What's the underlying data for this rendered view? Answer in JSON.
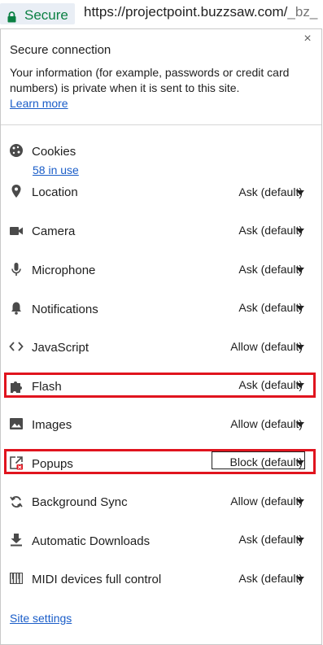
{
  "address_bar": {
    "secure_label": "Secure",
    "url_main": "https://projectpoint.buzzsaw.com/",
    "url_dim": "_bz_"
  },
  "popup": {
    "close_glyph": "×",
    "title": "Secure connection",
    "description": "Your information (for example, passwords or credit card numbers) is private when it is sent to this site.",
    "learn_more": "Learn more",
    "cookies": {
      "label": "Cookies",
      "link": "58 in use",
      "icon": "cookie-icon"
    },
    "permissions": [
      {
        "label": "Location",
        "value": "Ask (default)",
        "icon": "location-pin-icon"
      },
      {
        "label": "Camera",
        "value": "Ask (default)",
        "icon": "camera-icon"
      },
      {
        "label": "Microphone",
        "value": "Ask (default)",
        "icon": "microphone-icon"
      },
      {
        "label": "Notifications",
        "value": "Ask (default)",
        "icon": "bell-icon"
      },
      {
        "label": "JavaScript",
        "value": "Allow (default)",
        "icon": "code-icon"
      },
      {
        "label": "Flash",
        "value": "Ask (default)",
        "icon": "puzzle-icon"
      },
      {
        "label": "Images",
        "value": "Allow (default)",
        "icon": "image-icon"
      },
      {
        "label": "Popups",
        "value": "Block (default)",
        "icon": "popup-blocked-icon"
      },
      {
        "label": "Background Sync",
        "value": "Allow (default)",
        "icon": "sync-icon"
      },
      {
        "label": "Automatic Downloads",
        "value": "Ask (default)",
        "icon": "download-icon"
      },
      {
        "label": "MIDI devices full control",
        "value": "Ask (default)",
        "icon": "piano-keys-icon"
      }
    ],
    "site_settings": "Site settings"
  },
  "colors": {
    "secure_green": "#0b8043",
    "link_blue": "#1a5dc8",
    "highlight_red": "#e0141e",
    "chip_bg": "#e9eef5"
  }
}
